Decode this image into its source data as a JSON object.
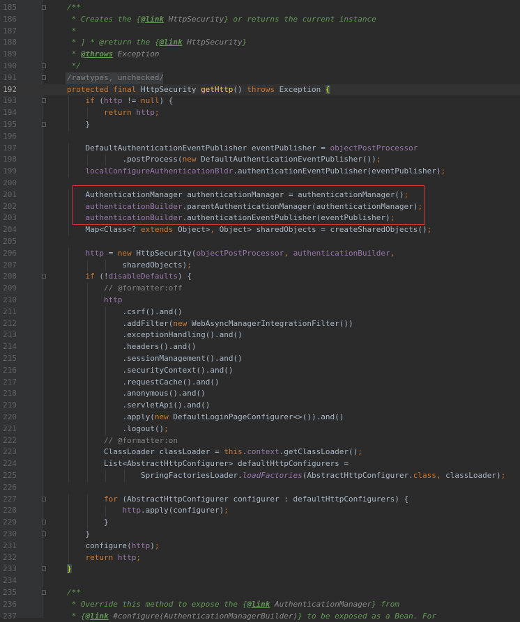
{
  "editor": {
    "language": "java",
    "current_line": 192,
    "highlight_box_lines": [
      201,
      203
    ],
    "colors": {
      "background": "#2b2b2b",
      "gutter": "#313335",
      "keyword": "#cc7832",
      "comment": "#629755",
      "field": "#9876aa",
      "method": "#ffc66d",
      "default_text": "#a9b7c6",
      "highlight_box": "#d33a3a"
    },
    "lines": [
      {
        "n": 185,
        "fold": true,
        "tokens": [
          [
            "cm",
            "/**"
          ]
        ]
      },
      {
        "n": 186,
        "tokens": [
          [
            "cm",
            " * Creates the {"
          ],
          [
            "cmtag",
            "@link"
          ],
          [
            "cmref",
            " HttpSecurity"
          ],
          [
            "cm",
            "} or returns the current instance"
          ]
        ]
      },
      {
        "n": 187,
        "tokens": [
          [
            "cm",
            " *"
          ]
        ]
      },
      {
        "n": 188,
        "tokens": [
          [
            "cm",
            " * ] * @return the {"
          ],
          [
            "cmtag",
            "@link"
          ],
          [
            "cmref",
            " HttpSecurity"
          ],
          [
            "cm",
            "}"
          ]
        ]
      },
      {
        "n": 189,
        "tokens": [
          [
            "cm",
            " * "
          ],
          [
            "cmtag",
            "@throws"
          ],
          [
            "cmref",
            " Exception"
          ]
        ]
      },
      {
        "n": 190,
        "fold": true,
        "tokens": [
          [
            "cm",
            " */"
          ]
        ]
      },
      {
        "n": 191,
        "fold": true,
        "anno": true,
        "tokens": [
          [
            "lc",
            "/rawtypes, unchecked/"
          ]
        ]
      },
      {
        "n": 192,
        "cur": true,
        "tokens": [
          [
            "kw",
            "protected final "
          ],
          [
            "t",
            "HttpSecurity "
          ],
          [
            "mt",
            "getHttp"
          ],
          [
            "t",
            "() "
          ],
          [
            "kw",
            "throws "
          ],
          [
            "t",
            "Exception "
          ],
          [
            "brace",
            "{"
          ]
        ]
      },
      {
        "n": 193,
        "fold": true,
        "indent": 1,
        "tokens": [
          [
            "kw",
            "if "
          ],
          [
            "t",
            "("
          ],
          [
            "fd",
            "http"
          ],
          [
            "t",
            " != "
          ],
          [
            "kw",
            "null"
          ],
          [
            "t",
            ") {"
          ]
        ]
      },
      {
        "n": 194,
        "indent": 2,
        "tokens": [
          [
            "kw",
            "return "
          ],
          [
            "fd",
            "http"
          ],
          [
            "kw",
            ";"
          ]
        ]
      },
      {
        "n": 195,
        "fold": true,
        "indent": 1,
        "tokens": [
          [
            "t",
            "}"
          ]
        ]
      },
      {
        "n": 196,
        "tokens": []
      },
      {
        "n": 197,
        "indent": 1,
        "tokens": [
          [
            "t",
            "DefaultAuthenticationEventPublisher eventPublisher = "
          ],
          [
            "fd",
            "objectPostProcessor"
          ]
        ]
      },
      {
        "n": 198,
        "indent": 3,
        "tokens": [
          [
            "t",
            ".postProcess("
          ],
          [
            "kw",
            "new "
          ],
          [
            "t",
            "DefaultAuthenticationEventPublisher())"
          ],
          [
            "kw",
            ";"
          ]
        ]
      },
      {
        "n": 199,
        "indent": 1,
        "tokens": [
          [
            "fd",
            "localConfigureAuthenticationBldr"
          ],
          [
            "t",
            ".authenticationEventPublisher(eventPublisher)"
          ],
          [
            "kw",
            ";"
          ]
        ]
      },
      {
        "n": 200,
        "tokens": []
      },
      {
        "n": 201,
        "indent": 1,
        "tokens": [
          [
            "t",
            "AuthenticationManager authenticationManager = authenticationManager()"
          ],
          [
            "kw",
            ";"
          ]
        ]
      },
      {
        "n": 202,
        "indent": 1,
        "tokens": [
          [
            "fd",
            "authenticationBuilder"
          ],
          [
            "t",
            ".parentAuthenticationManager(authenticationManager)"
          ],
          [
            "kw",
            ";"
          ]
        ]
      },
      {
        "n": 203,
        "indent": 1,
        "tokens": [
          [
            "fd",
            "authenticationBuilder"
          ],
          [
            "t",
            ".authenticationEventPublisher(eventPublisher)"
          ],
          [
            "kw",
            ";"
          ]
        ]
      },
      {
        "n": 204,
        "indent": 1,
        "tokens": [
          [
            "t",
            "Map<Class<? "
          ],
          [
            "kw",
            "extends "
          ],
          [
            "t",
            "Object>"
          ],
          [
            "kw",
            ", "
          ],
          [
            "t",
            "Object> sharedObjects = createSharedObjects()"
          ],
          [
            "kw",
            ";"
          ]
        ]
      },
      {
        "n": 205,
        "tokens": []
      },
      {
        "n": 206,
        "indent": 1,
        "tokens": [
          [
            "fd",
            "http"
          ],
          [
            "t",
            " = "
          ],
          [
            "kw",
            "new "
          ],
          [
            "t",
            "HttpSecurity("
          ],
          [
            "fd",
            "objectPostProcessor"
          ],
          [
            "kw",
            ", "
          ],
          [
            "fd",
            "authenticationBuilder"
          ],
          [
            "kw",
            ","
          ]
        ]
      },
      {
        "n": 207,
        "indent": 3,
        "tokens": [
          [
            "t",
            "sharedObjects)"
          ],
          [
            "kw",
            ";"
          ]
        ]
      },
      {
        "n": 208,
        "fold": true,
        "indent": 1,
        "tokens": [
          [
            "kw",
            "if "
          ],
          [
            "t",
            "(!"
          ],
          [
            "fd",
            "disableDefaults"
          ],
          [
            "t",
            ") {"
          ]
        ]
      },
      {
        "n": 209,
        "indent": 2,
        "tokens": [
          [
            "lc",
            "// @formatter:off"
          ]
        ]
      },
      {
        "n": 210,
        "indent": 2,
        "tokens": [
          [
            "fd",
            "http"
          ]
        ]
      },
      {
        "n": 211,
        "indent": 3,
        "tokens": [
          [
            "t",
            ".csrf().and()"
          ]
        ]
      },
      {
        "n": 212,
        "indent": 3,
        "tokens": [
          [
            "t",
            ".addFilter("
          ],
          [
            "kw",
            "new "
          ],
          [
            "t",
            "WebAsyncManagerIntegrationFilter())"
          ]
        ]
      },
      {
        "n": 213,
        "indent": 3,
        "tokens": [
          [
            "t",
            ".exceptionHandling().and()"
          ]
        ]
      },
      {
        "n": 214,
        "indent": 3,
        "tokens": [
          [
            "t",
            ".headers().and()"
          ]
        ]
      },
      {
        "n": 215,
        "indent": 3,
        "tokens": [
          [
            "t",
            ".sessionManagement().and()"
          ]
        ]
      },
      {
        "n": 216,
        "indent": 3,
        "tokens": [
          [
            "t",
            ".securityContext().and()"
          ]
        ]
      },
      {
        "n": 217,
        "indent": 3,
        "tokens": [
          [
            "t",
            ".requestCache().and()"
          ]
        ]
      },
      {
        "n": 218,
        "indent": 3,
        "tokens": [
          [
            "t",
            ".anonymous().and()"
          ]
        ]
      },
      {
        "n": 219,
        "indent": 3,
        "tokens": [
          [
            "t",
            ".servletApi().and()"
          ]
        ]
      },
      {
        "n": 220,
        "indent": 3,
        "tokens": [
          [
            "t",
            ".apply("
          ],
          [
            "kw",
            "new "
          ],
          [
            "t",
            "DefaultLoginPageConfigurer<>()).and()"
          ]
        ]
      },
      {
        "n": 221,
        "indent": 3,
        "tokens": [
          [
            "t",
            ".logout()"
          ],
          [
            "kw",
            ";"
          ]
        ]
      },
      {
        "n": 222,
        "indent": 2,
        "tokens": [
          [
            "lc",
            "// @formatter:on"
          ]
        ]
      },
      {
        "n": 223,
        "indent": 2,
        "tokens": [
          [
            "t",
            "ClassLoader classLoader = "
          ],
          [
            "kw",
            "this"
          ],
          [
            "t",
            "."
          ],
          [
            "fd",
            "context"
          ],
          [
            "t",
            ".getClassLoader()"
          ],
          [
            "kw",
            ";"
          ]
        ]
      },
      {
        "n": 224,
        "indent": 2,
        "tokens": [
          [
            "t",
            "List<AbstractHttpConfigurer> defaultHttpConfigurers ="
          ]
        ]
      },
      {
        "n": 225,
        "indent": 4,
        "tokens": [
          [
            "t",
            "SpringFactoriesLoader."
          ],
          [
            "st",
            "loadFactories"
          ],
          [
            "t",
            "(AbstractHttpConfigurer."
          ],
          [
            "kw",
            "class"
          ],
          [
            "kw",
            ", "
          ],
          [
            "t",
            "classLoader)"
          ],
          [
            "kw",
            ";"
          ]
        ]
      },
      {
        "n": 226,
        "tokens": []
      },
      {
        "n": 227,
        "fold": true,
        "indent": 2,
        "tokens": [
          [
            "kw",
            "for "
          ],
          [
            "t",
            "(AbstractHttpConfigurer configurer : defaultHttpConfigurers) {"
          ]
        ]
      },
      {
        "n": 228,
        "indent": 3,
        "tokens": [
          [
            "fd",
            "http"
          ],
          [
            "t",
            ".apply(configurer)"
          ],
          [
            "kw",
            ";"
          ]
        ]
      },
      {
        "n": 229,
        "fold": true,
        "indent": 2,
        "tokens": [
          [
            "t",
            "}"
          ]
        ]
      },
      {
        "n": 230,
        "fold": true,
        "indent": 1,
        "tokens": [
          [
            "t",
            "}"
          ]
        ]
      },
      {
        "n": 231,
        "indent": 1,
        "tokens": [
          [
            "t",
            "configure("
          ],
          [
            "fd",
            "http"
          ],
          [
            "t",
            ")"
          ],
          [
            "kw",
            ";"
          ]
        ]
      },
      {
        "n": 232,
        "indent": 1,
        "tokens": [
          [
            "kw",
            "return "
          ],
          [
            "fd",
            "http"
          ],
          [
            "kw",
            ";"
          ]
        ]
      },
      {
        "n": 233,
        "fold": true,
        "tokens": [
          [
            "brace",
            "}"
          ]
        ]
      },
      {
        "n": 234,
        "tokens": []
      },
      {
        "n": 235,
        "fold": true,
        "tokens": [
          [
            "cm",
            "/**"
          ]
        ]
      },
      {
        "n": 236,
        "tokens": [
          [
            "cm",
            " * Override this method to expose the {"
          ],
          [
            "cmtag",
            "@link"
          ],
          [
            "cmref",
            " AuthenticationManager"
          ],
          [
            "cm",
            "} from"
          ]
        ]
      },
      {
        "n": 237,
        "tokens": [
          [
            "cm",
            " * {"
          ],
          [
            "cmtag",
            "@link"
          ],
          [
            "cmref",
            " #configure(AuthenticationManagerBuilder)"
          ],
          [
            "cm",
            "} to be exposed as a Bean. For"
          ]
        ]
      }
    ]
  }
}
